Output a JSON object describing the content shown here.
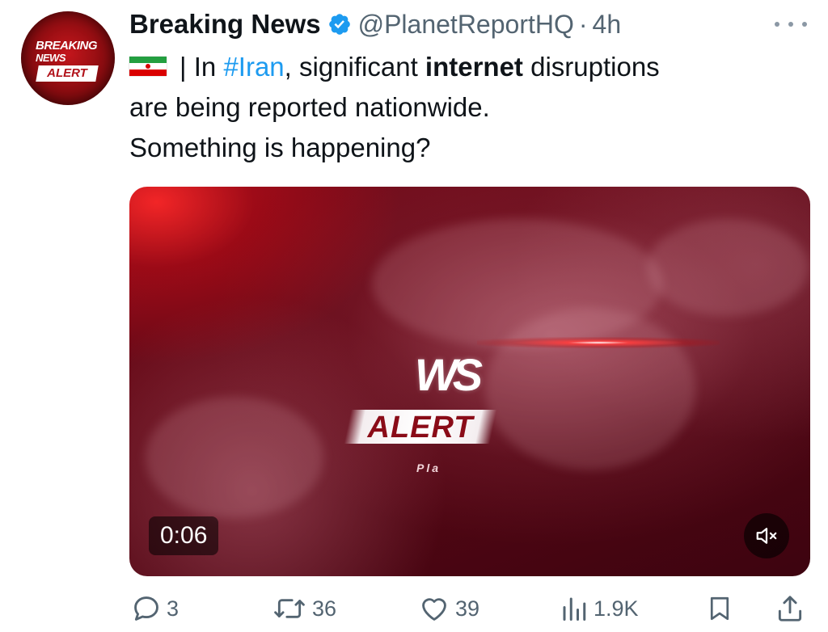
{
  "author": {
    "name": "Breaking News",
    "handle": "@PlanetReportHQ",
    "separator": "·",
    "time": "4h",
    "avatar_text": [
      "BREAKING",
      "NEWS",
      "ALERT"
    ]
  },
  "tweet": {
    "line1": {
      "prefix": "| In ",
      "hashtag": "#Iran",
      "mid": ", significant ",
      "bold": "internet",
      "suffix": " disruptions"
    },
    "line2": "are being reported nationwide.",
    "line3": "Something is happening?"
  },
  "video": {
    "logo": "WS",
    "alert": "ALERT",
    "subtitle": "Pla",
    "duration": "0:06",
    "muted": true
  },
  "actions": {
    "replies": "3",
    "reposts": "36",
    "likes": "39",
    "views": "1.9K"
  },
  "colors": {
    "link": "#1d9bf0",
    "verified": "#1d9bf0",
    "secondary_text": "#536471"
  },
  "icons": [
    "verified-badge-icon",
    "more-icon",
    "iran-flag-icon",
    "mute-icon",
    "reply-icon",
    "repost-icon",
    "like-icon",
    "views-icon",
    "bookmark-icon",
    "share-icon"
  ]
}
